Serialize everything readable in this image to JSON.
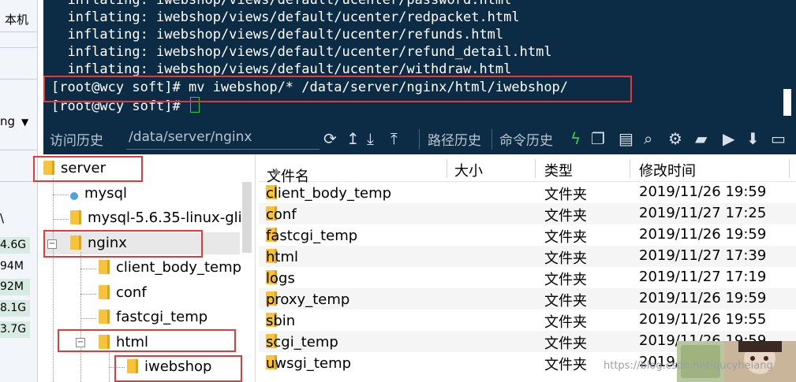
{
  "left_strip": {
    "top_label": "本机",
    "dropdown_label": "ng",
    "col_label": "\\",
    "sizes": [
      "4.6G",
      "94M",
      "92M",
      "8.1G",
      "3.7G"
    ]
  },
  "terminal": {
    "lines": [
      "  inflating: iwebshop/views/default/ucenter/password.html",
      "  inflating: iwebshop/views/default/ucenter/redpacket.html",
      "  inflating: iwebshop/views/default/ucenter/refunds.html",
      "  inflating: iwebshop/views/default/ucenter/refund_detail.html",
      "  inflating: iwebshop/views/default/ucenter/withdraw.html"
    ],
    "command_line": "[root@wcy soft]# mv iwebshop/* /data/server/nginx/html/iwebshop/",
    "prompt_line": "[root@wcy soft]# "
  },
  "toolbar": {
    "history_label": "访问历史",
    "current_path": "/data/server/nginx",
    "path_history_label": "路径历史",
    "command_history_label": "命令历史",
    "icons": [
      "refresh-icon",
      "upload-arrow-icon",
      "download-icon",
      "upload-icon",
      "lightning-icon",
      "copy-icon",
      "paste-icon",
      "search-icon",
      "gear-icon",
      "open-folder-icon",
      "play-icon",
      "down-arrow-icon",
      "window-icon"
    ]
  },
  "tree": {
    "nodes": [
      {
        "label": "server"
      },
      {
        "label": "mysql"
      },
      {
        "label": "mysql-5.6.35-linux-gli"
      },
      {
        "label": "nginx"
      },
      {
        "label": "client_body_temp"
      },
      {
        "label": "conf"
      },
      {
        "label": "fastcgi_temp"
      },
      {
        "label": "html"
      },
      {
        "label": "iwebshop"
      }
    ]
  },
  "filelist": {
    "columns": [
      "文件名",
      "大小",
      "类型",
      "修改时间"
    ],
    "rows": [
      {
        "name": "client_body_temp",
        "size": "",
        "type": "文件夹",
        "modified": "2019/11/26 19:59"
      },
      {
        "name": "conf",
        "size": "",
        "type": "文件夹",
        "modified": "2019/11/27 17:25"
      },
      {
        "name": "fastcgi_temp",
        "size": "",
        "type": "文件夹",
        "modified": "2019/11/26 19:59"
      },
      {
        "name": "html",
        "size": "",
        "type": "文件夹",
        "modified": "2019/11/27 17:39"
      },
      {
        "name": "logs",
        "size": "",
        "type": "文件夹",
        "modified": "2019/11/27 17:19"
      },
      {
        "name": "proxy_temp",
        "size": "",
        "type": "文件夹",
        "modified": "2019/11/26 19:59"
      },
      {
        "name": "sbin",
        "size": "",
        "type": "文件夹",
        "modified": "2019/11/26 19:55"
      },
      {
        "name": "scgi_temp",
        "size": "",
        "type": "文件夹",
        "modified": "2019/11/26 19:59"
      },
      {
        "name": "uwsgi_temp",
        "size": "",
        "type": "文件夹",
        "modified": "2019/"
      }
    ]
  },
  "watermark": "https://blog.csdn.net/qucyheiang",
  "colors": {
    "terminal_bg": "#0c2c46",
    "highlight": "#e03a3a",
    "cursor": "#22cc44"
  }
}
